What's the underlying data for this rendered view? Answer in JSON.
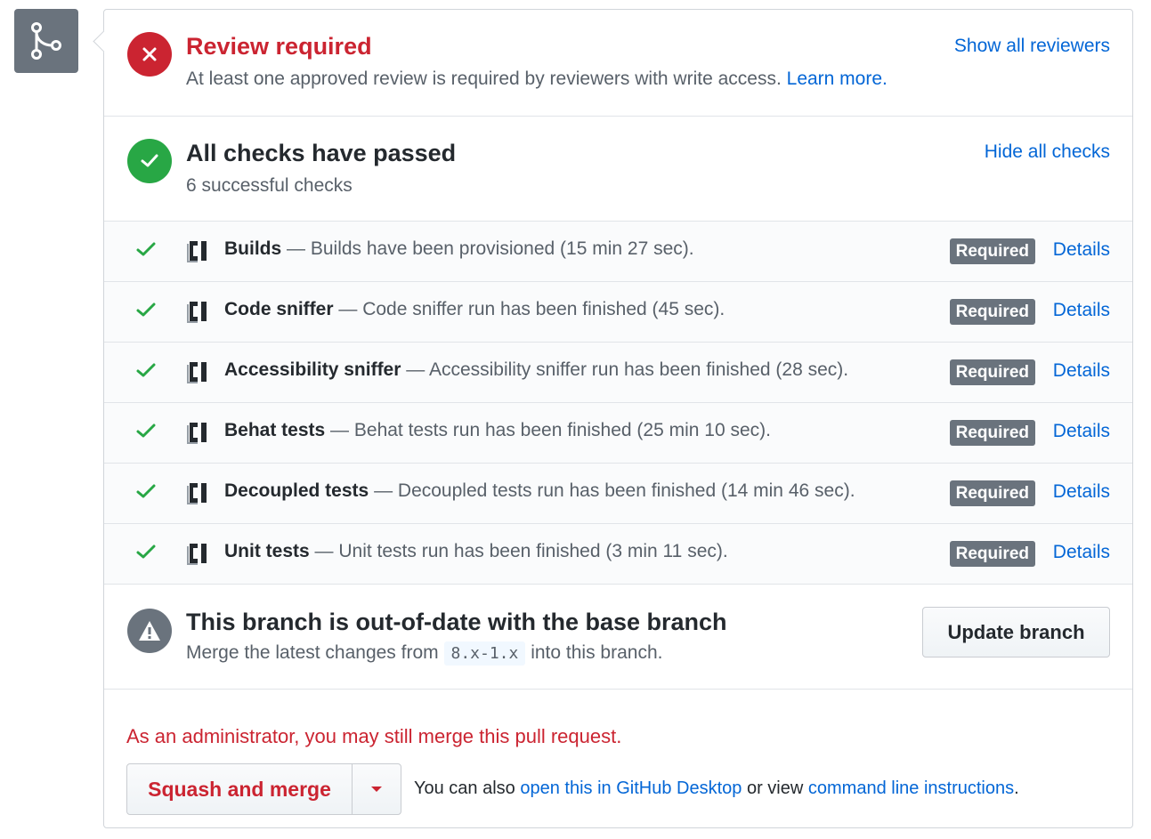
{
  "review": {
    "title": "Review required",
    "description": "At least one approved review is required by reviewers with write access.",
    "learn_more": "Learn more.",
    "show_all_reviewers": "Show all reviewers"
  },
  "checks": {
    "title": "All checks have passed",
    "summary": "6 successful checks",
    "hide_all": "Hide all checks",
    "items": [
      {
        "name": "Builds",
        "description": "— Builds have been provisioned (15 min 27 sec).",
        "badge": "Required",
        "details": "Details"
      },
      {
        "name": "Code sniffer",
        "description": "— Code sniffer run has been finished (45 sec).",
        "badge": "Required",
        "details": "Details"
      },
      {
        "name": "Accessibility sniffer",
        "description": "— Accessibility sniffer run has been finished (28 sec).",
        "badge": "Required",
        "details": "Details"
      },
      {
        "name": "Behat tests",
        "description": "— Behat tests run has been finished (25 min 10 sec).",
        "badge": "Required",
        "details": "Details"
      },
      {
        "name": "Decoupled tests",
        "description": "— Decoupled tests run has been finished (14 min 46 sec).",
        "badge": "Required",
        "details": "Details"
      },
      {
        "name": "Unit tests",
        "description": "— Unit tests run has been finished (3 min 11 sec).",
        "badge": "Required",
        "details": "Details"
      }
    ]
  },
  "branch": {
    "title": "This branch is out-of-date with the base branch",
    "text_before": "Merge the latest changes from",
    "base_branch": "8.x-1.x",
    "text_after": "into this branch.",
    "update_button": "Update branch"
  },
  "merge": {
    "admin_note": "As an administrator, you may still merge this pull request.",
    "button_label": "Squash and merge",
    "also_prefix": "You can also",
    "desktop_link": "open this in GitHub Desktop",
    "or_view": "or view",
    "cli_link": "command line instructions",
    "suffix": "."
  },
  "colors": {
    "error": "#cb2431",
    "success": "#28a745",
    "link": "#0366d6",
    "neutral": "#6a737d"
  }
}
